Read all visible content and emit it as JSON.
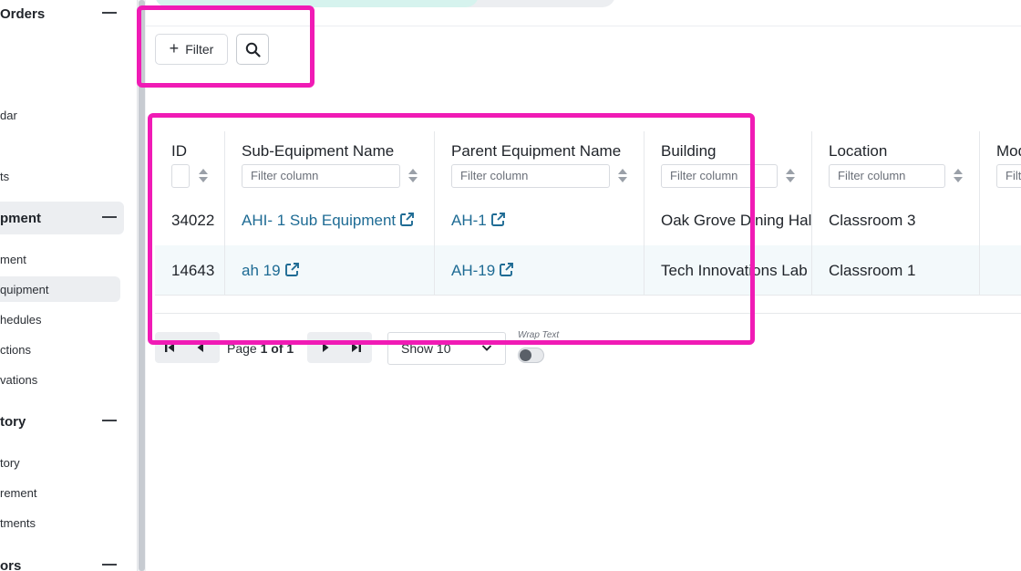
{
  "sidebar": {
    "sections": [
      {
        "label": "Orders"
      },
      {
        "label": "pment"
      },
      {
        "label": "tory"
      },
      {
        "label": "ors"
      }
    ],
    "items": [
      {
        "label": "dar"
      },
      {
        "label": "ts"
      },
      {
        "label": "ment"
      },
      {
        "label": "quipment"
      },
      {
        "label": "hedules"
      },
      {
        "label": "ctions"
      },
      {
        "label": "vations"
      },
      {
        "label": "tory"
      },
      {
        "label": "rement"
      },
      {
        "label": "tments"
      }
    ]
  },
  "toolbar": {
    "filter_label": "Filter"
  },
  "table": {
    "columns": [
      {
        "label": "ID",
        "filter_placeholder": ""
      },
      {
        "label": "Sub-Equipment Name",
        "filter_placeholder": "Filter column"
      },
      {
        "label": "Parent Equipment Name",
        "filter_placeholder": "Filter column"
      },
      {
        "label": "Building",
        "filter_placeholder": "Filter column"
      },
      {
        "label": "Location",
        "filter_placeholder": "Filter column"
      },
      {
        "label": "Mod",
        "filter_placeholder": "Filt"
      }
    ],
    "rows": [
      {
        "id": "34022",
        "sub_name": "AHI- 1 Sub Equipment",
        "parent_name": "AH-1",
        "building": "Oak Grove Dining Hall",
        "location": "Classroom 3",
        "model": ""
      },
      {
        "id": "14643",
        "sub_name": "ah 19",
        "parent_name": "AH-19",
        "building": "Tech Innovations Lab",
        "location": "Classroom 1",
        "model": ""
      }
    ]
  },
  "pagination": {
    "page_prefix": "Page ",
    "page_value": "1 of 1",
    "show_value": "Show 10",
    "wrap_label": "Wrap Text",
    "wrap_enabled": false
  },
  "colors": {
    "highlight": "#f01bb5",
    "link": "#1e6b94",
    "row_alt": "#f3f9fb"
  }
}
